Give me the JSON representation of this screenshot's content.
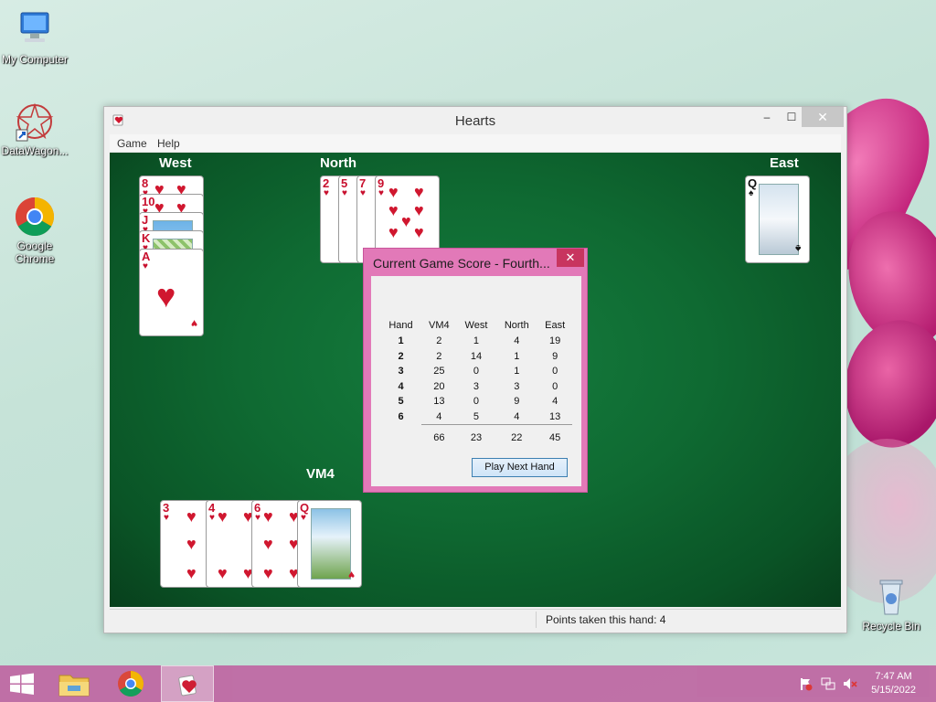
{
  "desktop": {
    "icons": [
      {
        "label": "My Computer"
      },
      {
        "label": "DataWagon..."
      },
      {
        "label": "Google Chrome"
      },
      {
        "label": "Recycle Bin"
      }
    ]
  },
  "window": {
    "title": "Hearts",
    "minimize": "–",
    "maximize": "☐",
    "close": "✕",
    "menu": [
      "Game",
      "Help"
    ]
  },
  "players": {
    "west": "West",
    "north": "North",
    "east": "East",
    "south": "VM4"
  },
  "hands": {
    "west": [
      {
        "rank": "8",
        "suit": "♥"
      },
      {
        "rank": "10",
        "suit": "♥"
      },
      {
        "rank": "J",
        "suit": "♥"
      },
      {
        "rank": "K",
        "suit": "♥"
      },
      {
        "rank": "A",
        "suit": "♥"
      }
    ],
    "north": [
      {
        "rank": "2",
        "suit": "♥"
      },
      {
        "rank": "5",
        "suit": "♥"
      },
      {
        "rank": "7",
        "suit": "♥"
      },
      {
        "rank": "9",
        "suit": "♥"
      }
    ],
    "east": [
      {
        "rank": "Q",
        "suit": "♠"
      }
    ],
    "south": [
      {
        "rank": "3",
        "suit": "♥"
      },
      {
        "rank": "4",
        "suit": "♥"
      },
      {
        "rank": "6",
        "suit": "♥"
      },
      {
        "rank": "Q",
        "suit": "♥"
      }
    ]
  },
  "dialog": {
    "title": "Current Game Score - Fourth...",
    "close": "✕",
    "headers": [
      "Hand",
      "VM4",
      "West",
      "North",
      "East"
    ],
    "rows": [
      [
        "1",
        "2",
        "1",
        "4",
        "19"
      ],
      [
        "2",
        "2",
        "14",
        "1",
        "9"
      ],
      [
        "3",
        "25",
        "0",
        "1",
        "0"
      ],
      [
        "4",
        "20",
        "3",
        "3",
        "0"
      ],
      [
        "5",
        "13",
        "0",
        "9",
        "4"
      ],
      [
        "6",
        "4",
        "5",
        "4",
        "13"
      ]
    ],
    "totals": [
      "",
      "66",
      "23",
      "22",
      "45"
    ],
    "button": "Play Next Hand"
  },
  "status": {
    "text": "Points taken this hand: 4"
  },
  "taskbar": {
    "time": "7:47 AM",
    "date": "5/15/2022"
  },
  "colors": {
    "felt": "#0f6a32",
    "taskbar": "#bf6ca5",
    "dialog_frame": "#e279b8",
    "heart_red": "#d0172f"
  }
}
